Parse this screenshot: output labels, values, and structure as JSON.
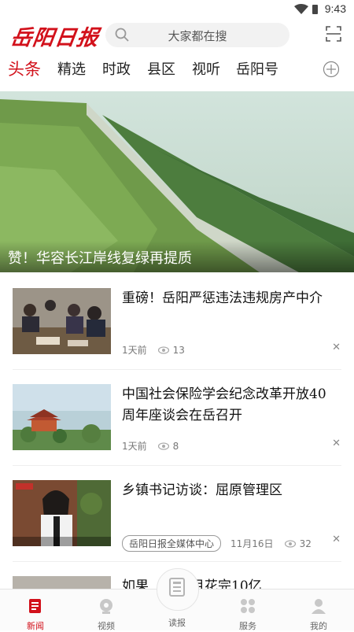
{
  "status": {
    "time": "9:43"
  },
  "header": {
    "logo_text": "岳阳日报",
    "search_placeholder": "大家都在搜"
  },
  "tabs": [
    {
      "label": "头条",
      "active": true
    },
    {
      "label": "精选"
    },
    {
      "label": "时政"
    },
    {
      "label": "县区"
    },
    {
      "label": "视听"
    },
    {
      "label": "岳阳号"
    }
  ],
  "hero": {
    "caption": "赞！华容长江岸线复绿再提质"
  },
  "news": [
    {
      "title": "重磅！岳阳严惩违法违规房产中介",
      "time": "1天前",
      "views": "13"
    },
    {
      "title": "中国社会保险学会纪念改革开放40周年座谈会在岳召开",
      "time": "1天前",
      "views": "8"
    },
    {
      "title": "乡镇书记访谈：屈原管理区",
      "tag": "岳阳日报全媒体中心",
      "date": "11月16日",
      "views": "32"
    },
    {
      "title": "如果          月花完10亿"
    }
  ],
  "bottom_nav": [
    {
      "label": "新闻",
      "icon": "news-icon",
      "active": true
    },
    {
      "label": "视频",
      "icon": "video-icon"
    },
    {
      "label": "读报",
      "icon": "newspaper-icon"
    },
    {
      "label": "服务",
      "icon": "services-icon"
    },
    {
      "label": "我的",
      "icon": "profile-icon"
    }
  ],
  "colors": {
    "accent": "#d2111b"
  }
}
